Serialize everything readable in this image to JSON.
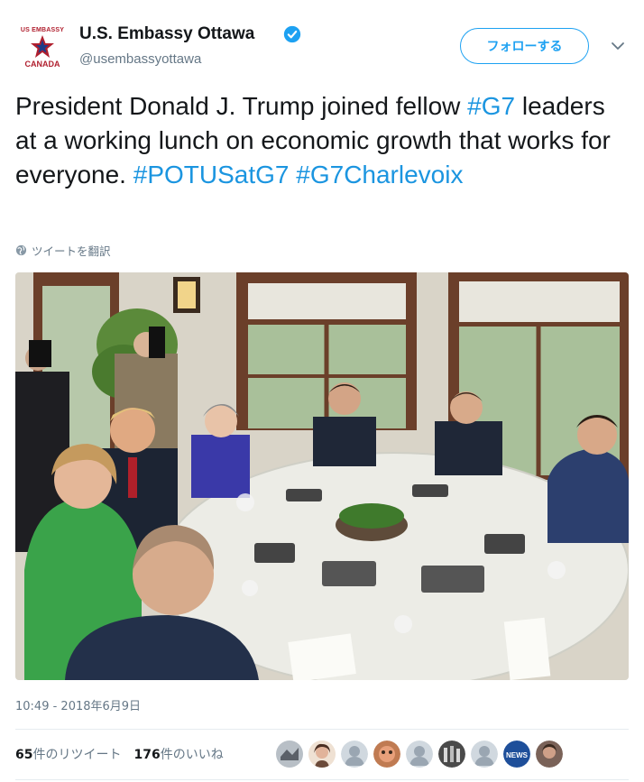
{
  "profile": {
    "logo_top_text": "US EMBASSY",
    "logo_bottom_text": "CANADA",
    "display_name": "U.S. Embassy Ottawa",
    "handle": "@usembassyottawa",
    "verified_icon": "verified-badge-icon",
    "follow_label": "フォローする",
    "menu_icon": "chevron-down-icon"
  },
  "tweet": {
    "part1": "President Donald J. Trump joined fellow ",
    "hashtag1": "#G7",
    "part2": " leaders at a working lunch on economic growth that works for everyone. ",
    "hashtag2": "#POTUSatG7",
    "hashtag3": "#G7Charlevoix",
    "translate_label": "ツイートを翻訳"
  },
  "timestamp": "10:49 - 2018年6月9日",
  "stats": {
    "retweet_count": "65",
    "retweet_label": "件のリツイート",
    "like_count": "176",
    "like_label": "件のいいね"
  },
  "avatars": [
    {
      "name": "avatar-1",
      "color": "#8a8f96"
    },
    {
      "name": "avatar-2",
      "color": "#6b4a3a"
    },
    {
      "name": "avatar-3",
      "color": "#c8d0d8"
    },
    {
      "name": "avatar-4",
      "color": "#b06a45"
    },
    {
      "name": "avatar-5",
      "color": "#c8d0d8"
    },
    {
      "name": "avatar-6",
      "color": "#3c3c3c"
    },
    {
      "name": "avatar-7",
      "color": "#c8d0d8"
    },
    {
      "name": "avatar-8",
      "color": "#1e4f9a",
      "text": "NEWS"
    },
    {
      "name": "avatar-9",
      "color": "#6a5248"
    }
  ],
  "colors": {
    "accent": "#1da1f2",
    "hashtag": "#1b95e0",
    "secondary_text": "#657786",
    "brand_red": "#b01f2e"
  }
}
